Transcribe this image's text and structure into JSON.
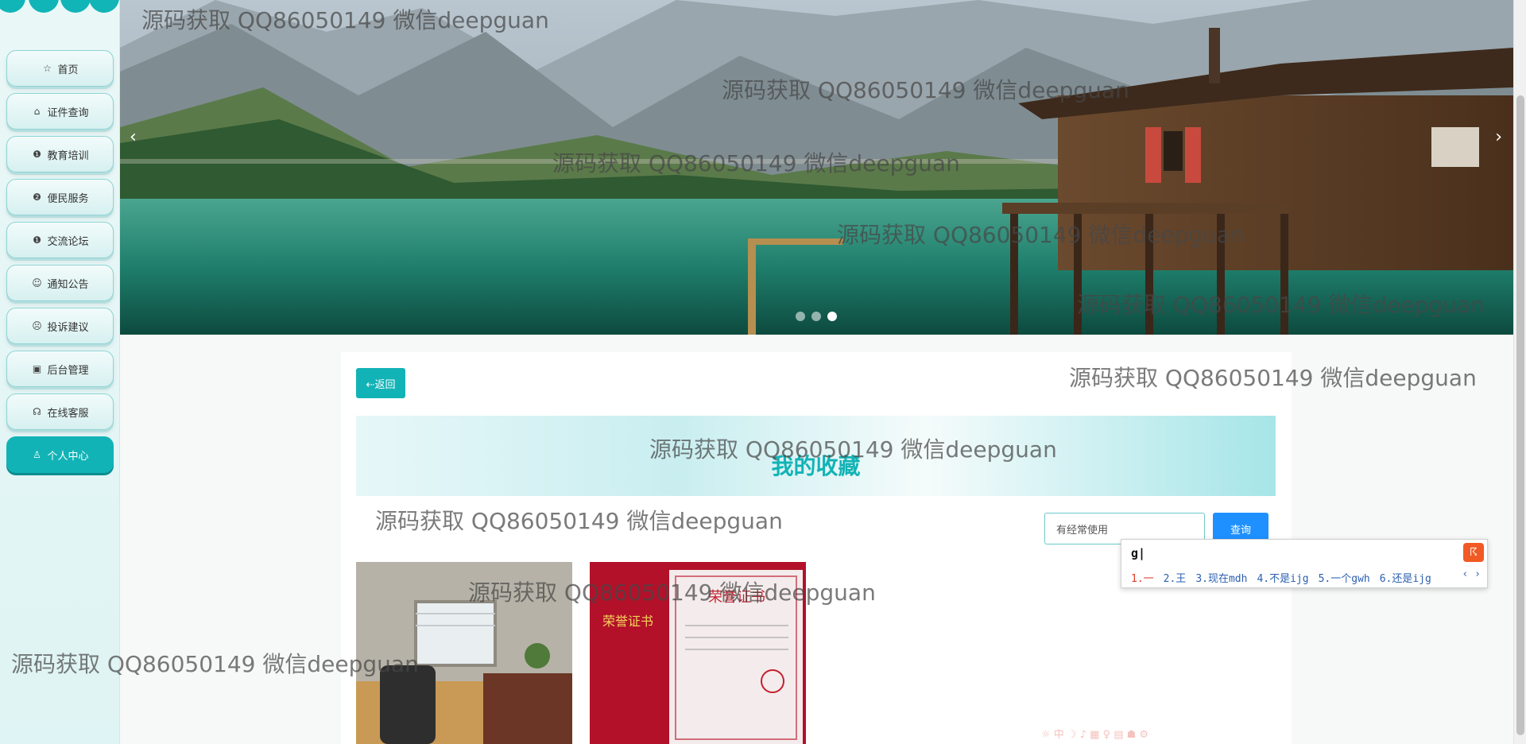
{
  "sidebar": {
    "items": [
      {
        "label": "首页",
        "icon": "star-icon",
        "glyph": "☆"
      },
      {
        "label": "证件查询",
        "icon": "lock-icon",
        "glyph": "⌂"
      },
      {
        "label": "教育培训",
        "icon": "info-circle-icon",
        "glyph": "❶"
      },
      {
        "label": "便民服务",
        "icon": "question-circle-icon",
        "glyph": "❷"
      },
      {
        "label": "交流论坛",
        "icon": "info-circle-icon",
        "glyph": "❶"
      },
      {
        "label": "通知公告",
        "icon": "smile-icon",
        "glyph": "☺"
      },
      {
        "label": "投诉建议",
        "icon": "frown-icon",
        "glyph": "☹"
      },
      {
        "label": "后台管理",
        "icon": "briefcase-icon",
        "glyph": "▣"
      },
      {
        "label": "在线客服",
        "icon": "headset-icon",
        "glyph": "☊"
      },
      {
        "label": "个人中心",
        "icon": "user-icon",
        "glyph": "♙",
        "active": true
      }
    ]
  },
  "banner": {
    "prev_glyph": "‹",
    "next_glyph": "›",
    "dots": 3,
    "active_dot": 3
  },
  "main": {
    "back_label": "⇠返回",
    "title": "我的收藏",
    "search_value": "有经常使用",
    "search_button": "查询"
  },
  "ime": {
    "composition": "g|",
    "candidates": [
      "1.一",
      "2.王",
      "3.现在mdh",
      "4.不是ijg",
      "5.一个gwh",
      "6.还是ijg"
    ],
    "nav": "‹ ›"
  },
  "ime_toolbar": "☼ 中 ☽ ♪ ▦ ♀ ▤ ☗ ⚙",
  "watermark": "源码获取 QQ86050149 微信deepguan",
  "colors": {
    "accent": "#12b3b6",
    "search_button": "#1e90ff",
    "ime_logo": "#f15a24"
  }
}
